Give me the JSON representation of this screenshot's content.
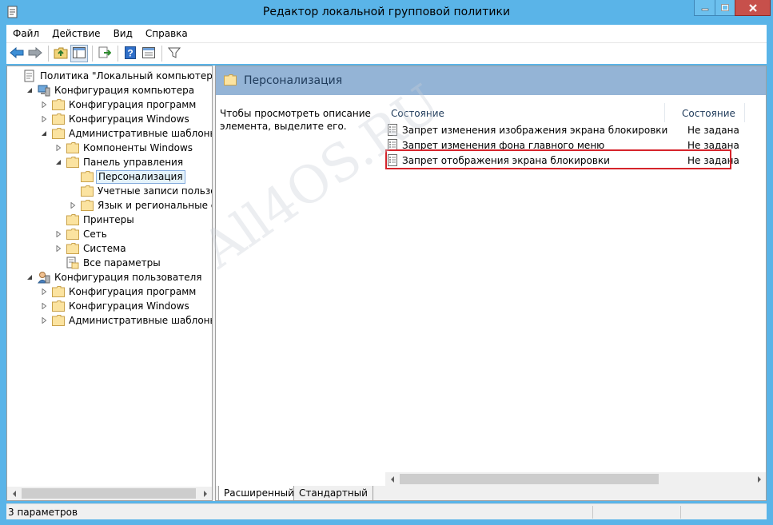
{
  "window": {
    "title": "Редактор локальной групповой политики"
  },
  "menu": [
    "Файл",
    "Действие",
    "Вид",
    "Справка"
  ],
  "toolbar": {
    "buttons": [
      "back-icon",
      "forward-icon",
      "up-folder-icon",
      "show-hide-tree-icon",
      "export-list-icon",
      "help-icon",
      "properties-icon",
      "filter-icon"
    ]
  },
  "tree": {
    "items": [
      {
        "label": "Политика \"Локальный компьютер\"",
        "icon": "policy-doc-icon",
        "arrow": "none"
      },
      {
        "label": "Конфигурация компьютера",
        "icon": "computer-icon",
        "arrow": "expanded"
      },
      {
        "label": "Конфигурация программ",
        "icon": "folder-icon",
        "arrow": "collapsed"
      },
      {
        "label": "Конфигурация Windows",
        "icon": "folder-icon",
        "arrow": "collapsed"
      },
      {
        "label": "Административные шаблоны",
        "icon": "folder-icon",
        "arrow": "expanded"
      },
      {
        "label": "Компоненты Windows",
        "icon": "folder-icon",
        "arrow": "collapsed"
      },
      {
        "label": "Панель управления",
        "icon": "folder-icon",
        "arrow": "expanded"
      },
      {
        "label": "Персонализация",
        "icon": "folder-icon",
        "arrow": "none",
        "selected": true
      },
      {
        "label": "Учетные записи пользовате",
        "icon": "folder-icon",
        "arrow": "none"
      },
      {
        "label": "Язык и региональные станда",
        "icon": "folder-icon",
        "arrow": "collapsed"
      },
      {
        "label": "Принтеры",
        "icon": "folder-icon",
        "arrow": "none"
      },
      {
        "label": "Сеть",
        "icon": "folder-icon",
        "arrow": "collapsed"
      },
      {
        "label": "Система",
        "icon": "folder-icon",
        "arrow": "collapsed"
      },
      {
        "label": "Все параметры",
        "icon": "all-settings-icon",
        "arrow": "none"
      },
      {
        "label": "Конфигурация пользователя",
        "icon": "user-icon",
        "arrow": "expanded"
      },
      {
        "label": "Конфигурация программ",
        "icon": "folder-icon",
        "arrow": "collapsed"
      },
      {
        "label": "Конфигурация Windows",
        "icon": "folder-icon",
        "arrow": "collapsed"
      },
      {
        "label": "Административные шаблоны",
        "icon": "folder-icon",
        "arrow": "collapsed"
      }
    ]
  },
  "details": {
    "header_title": "Персонализация",
    "description": "Чтобы просмотреть описание элемента, выделите его.",
    "columns": [
      "Состояние",
      "Состояние"
    ],
    "rows": [
      {
        "name": "Запрет изменения изображения экрана блокировки",
        "state": "Не задана"
      },
      {
        "name": "Запрет изменения фона главного меню",
        "state": "Не задана"
      },
      {
        "name": "Запрет отображения экрана блокировки",
        "state": "Не задана",
        "highlighted": true
      }
    ]
  },
  "tabs": [
    "Расширенный",
    "Стандартный"
  ],
  "status": {
    "text": "3 параметров"
  },
  "watermark": "All4OS.RU",
  "colors": {
    "window_frame": "#5ab4e8",
    "header_band": "#94b4d6",
    "highlight_box": "#d6242b",
    "close_button": "#c7504b"
  }
}
